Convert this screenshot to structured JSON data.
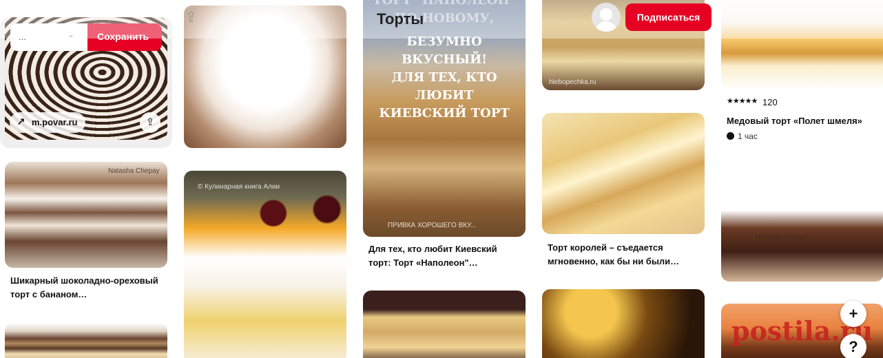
{
  "header": {
    "board_title": "Торты",
    "subscribe_label": "Подписаться",
    "avatar_icon": "user-avatar-icon"
  },
  "first_pin": {
    "board_dropdown_value": "...",
    "save_label": "Сохранить",
    "domain": "m.povar.ru"
  },
  "pins": [
    {
      "title": "Шикарный шоколадно-ореховый торт с бананом…"
    },
    {
      "title": "Для тех, кто любит Киевский торт: Торт «Наполеон\"…"
    },
    {
      "title": "Торт королей – съедается мгновенно, как бы ни были…"
    },
    {
      "title": "Медовый торт «Полет шмеля»",
      "rating": "★★★★★",
      "rating_count": "120",
      "time": "1 час"
    }
  ],
  "napoleon_banner": {
    "line1": "ТОРТ \"НАПОЛЕОН\"",
    "line2": "ПО-НОВОМУ,",
    "line3": "БЕЗУМНО ВКУСНЫЙ!",
    "line4": "ДЛЯ ТЕХ, КТО ЛЮБИТ",
    "line5": "КИЕВСКИЙ ТОРТ",
    "footer": "ПРИВКА ХОРОШЕГО ВКУ..."
  },
  "watermarks": {
    "hlebopechka": "hlebopechka.ru",
    "natasha": "Natasha Chepay",
    "alia": "© Кулинарная книга Алии",
    "postila": "postila.ru"
  },
  "fab": {
    "plus": "+",
    "help": "?"
  }
}
